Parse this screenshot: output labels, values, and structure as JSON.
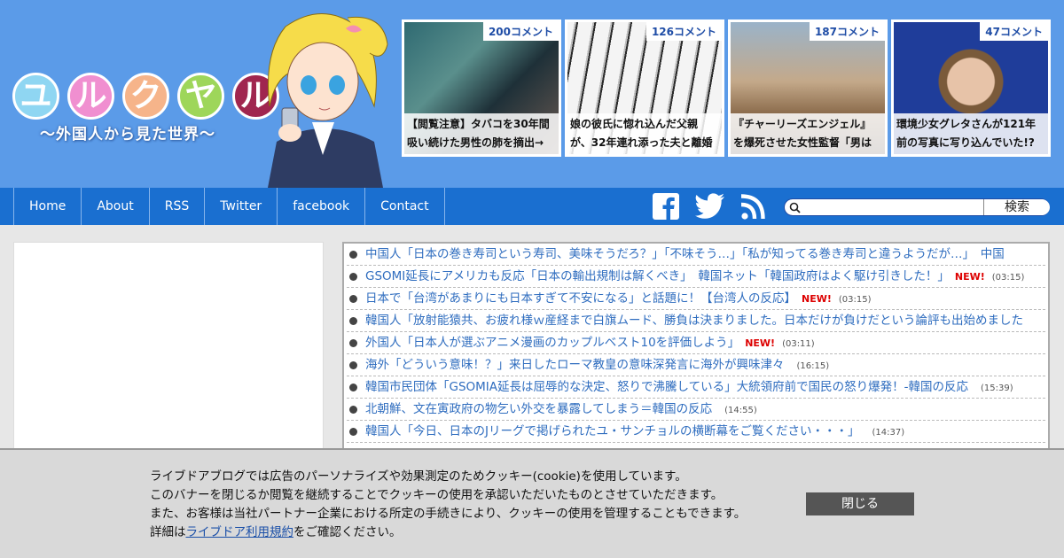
{
  "header": {
    "logo": {
      "letters": [
        {
          "char": "ユ",
          "color": "#8fd6f2"
        },
        {
          "char": "ル",
          "color": "#f08fd0"
        },
        {
          "char": "ク",
          "color": "#f6b48a"
        },
        {
          "char": "ヤ",
          "color": "#9ed65a"
        },
        {
          "char": "ル",
          "color": "#a0264f"
        }
      ],
      "subtitle": "〜外国人から見た世界〜"
    },
    "featured": [
      {
        "count": "200コメント",
        "line1": "【閲覧注意】タバコを30年間",
        "line2": "吸い続けた男性の肺を摘出→"
      },
      {
        "count": "126コメント",
        "line1": "娘の彼氏に惚れ込んだ父親",
        "line2": "が、32年連れ添った夫と離婚"
      },
      {
        "count": "187コメント",
        "line1": "『チャーリーズエンジェル』",
        "line2": "を爆死させた女性監督「男は"
      },
      {
        "count": "47コメント",
        "line1": "環境少女グレタさんが121年",
        "line2": "前の写真に写り込んでいた!?"
      }
    ]
  },
  "nav": {
    "items": [
      "Home",
      "About",
      "RSS",
      "Twitter",
      "facebook",
      "Contact"
    ],
    "search_button": "検索",
    "search_placeholder": ""
  },
  "feed": [
    {
      "title": "中国人「日本の巻き寿司という寿司、美味そうだろ？」「不味そう…」「私が知ってる巻き寿司と違うようだが…」　中国",
      "new": "",
      "time": ""
    },
    {
      "title": "GSOMI延長にアメリカも反応「日本の輸出規制は解くべき」　韓国ネット「韓国政府はよく駆け引きした！」",
      "new": "NEW!",
      "time": "(03:15)"
    },
    {
      "title": "日本で「台湾があまりにも日本すぎて不安になる」と話題に！【台湾人の反応】",
      "new": "NEW!",
      "time": "(03:15)"
    },
    {
      "title": "韓国人「放射能猿共、お疲れ様ｗ産経まで白旗ムード、勝負は決まりました。日本だけが負けだという論評も出始めました",
      "new": "",
      "time": ""
    },
    {
      "title": "外国人「日本人が選ぶアニメ漫画のカップルベスト10を評価しよう」",
      "new": "NEW!",
      "time": "(03:11)"
    },
    {
      "title": "海外「どういう意味！？」来日したローマ教皇の意味深発言に海外が興味津々",
      "new": "",
      "time": "(16:15)"
    },
    {
      "title": "韓国市民団体「GSOMIA延長は屈辱的な決定、怒りで沸騰している」大統領府前で国民の怒り爆発！-韓国の反応",
      "new": "",
      "time": "(15:39)"
    },
    {
      "title": "北朝鮮、文在寅政府の物乞い外交を暴露してしまう＝韓国の反応",
      "new": "",
      "time": "(14:55)"
    },
    {
      "title": "韓国人「今日、日本のJリーグで掲げられたユ・サンチョルの横断幕をご覧ください・・・」",
      "new": "",
      "time": "(14:37)"
    }
  ],
  "cookie": {
    "line1": "ライブドアブログでは広告のパーソナライズや効果測定のためクッキー(cookie)を使用しています。",
    "line2": "このバナーを閉じるか閲覧を継続することでクッキーの使用を承認いただいたものとさせていただきます。",
    "line3": "また、お客様は当社パートナー企業における所定の手続きにより、クッキーの使用を管理することもできます。",
    "line4_pre": "詳細は",
    "line4_link": "ライブドア利用規約",
    "line4_post": "をご確認ください。",
    "close_label": "閉じる"
  }
}
